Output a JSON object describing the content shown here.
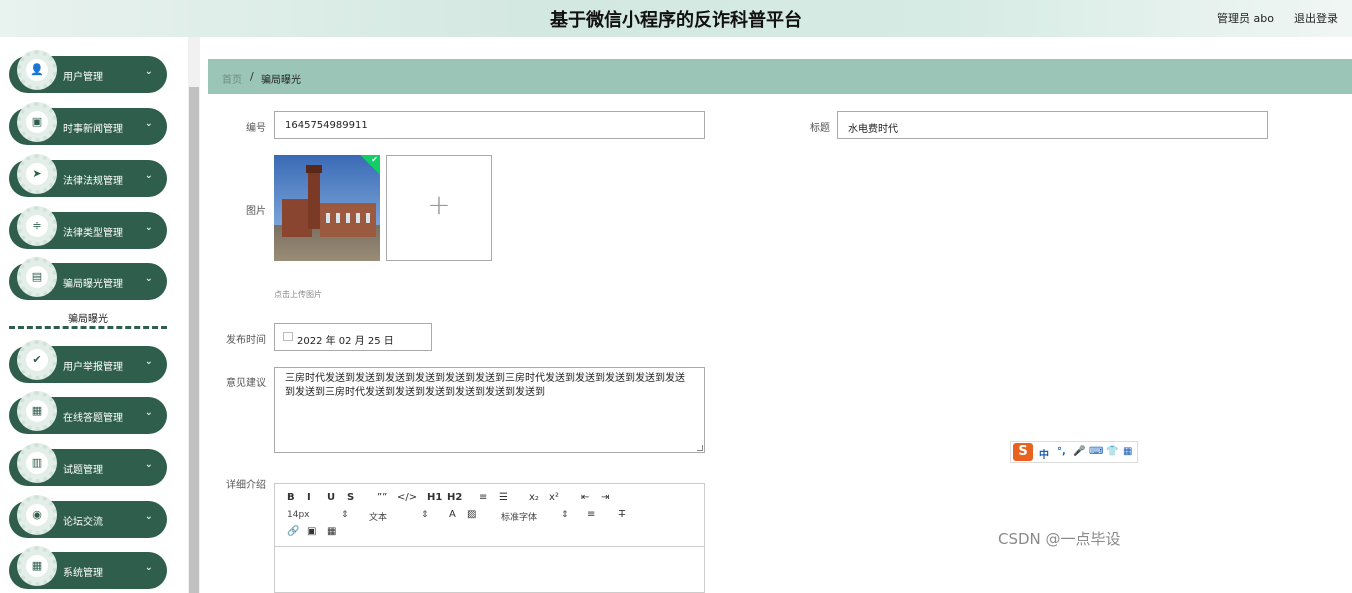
{
  "header": {
    "title": "基于微信小程序的反诈科普平台",
    "user_label": "管理员 abo",
    "logout_label": "退出登录"
  },
  "sidebar": {
    "items": [
      {
        "label": "用户管理",
        "icon": "user-icon",
        "glyph": "👤"
      },
      {
        "label": "时事新闻管理",
        "icon": "news-icon",
        "glyph": "▣"
      },
      {
        "label": "法律法规管理",
        "icon": "send-icon",
        "glyph": "➤"
      },
      {
        "label": "法律类型管理",
        "icon": "sliders-icon",
        "glyph": "≑"
      },
      {
        "label": "骗局曝光管理",
        "icon": "briefcase-icon",
        "glyph": "▤"
      },
      {
        "label": "用户举报管理",
        "icon": "clipboard-icon",
        "glyph": "✔"
      },
      {
        "label": "在线答题管理",
        "icon": "grid-icon",
        "glyph": "▦"
      },
      {
        "label": "试题管理",
        "icon": "document-icon",
        "glyph": "▥"
      },
      {
        "label": "论坛交流",
        "icon": "pin-icon",
        "glyph": "◉"
      },
      {
        "label": "系统管理",
        "icon": "grid-icon",
        "glyph": "▦"
      }
    ],
    "submenu": {
      "label": "骗局曝光"
    },
    "chevron": "⌄"
  },
  "breadcrumb": {
    "home": "首页",
    "separator": "/",
    "current": "骗局曝光"
  },
  "form": {
    "id_label": "编号",
    "id_value": "1645754989911",
    "title_label": "标题",
    "title_value": "水电费时代",
    "image_label": "图片",
    "add_glyph": "+",
    "upload_tip": "点击上传图片",
    "date_label": "发布时间",
    "date_value": "2022 年 02 月 25 日",
    "suggestion_label": "意见建议",
    "suggestion_value": "三房时代发送到发送到发送到发送到发送到发送到三房时代发送到发送到发送到发送到发送到发送到三房时代发送到发送到发送到发送到发送到发送到",
    "detail_label": "详细介绍"
  },
  "editor": {
    "row1": [
      "B",
      "I",
      "U",
      "S",
      "””",
      "</>",
      "H1",
      "H2",
      "≡",
      "☰",
      "x₂",
      "x²",
      "⇤",
      "⇥"
    ],
    "font_size": "14px",
    "text_type": "文本",
    "font_family": "标准字体",
    "row3": [
      "🔗",
      "▣",
      "▦"
    ]
  },
  "ime": {
    "logo": "S",
    "keys": [
      "中",
      "°,",
      "🎤",
      "⌨",
      "👕",
      "▦"
    ]
  },
  "watermark": "CSDN @一点毕设",
  "colors": {
    "sidebar_green": "#2f5e4c",
    "breadcrumb_bg": "#9bc5b6",
    "success_check": "#13ce66"
  }
}
